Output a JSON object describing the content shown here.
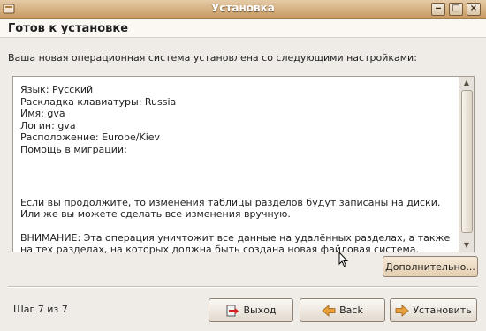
{
  "window": {
    "title": "Установка",
    "icon": "installer-icon",
    "controls": [
      "minimize-icon",
      "maximize-icon",
      "close-icon"
    ]
  },
  "header": {
    "title": "Готов к установке"
  },
  "intro": "Ваша новая операционная система установлена со следующими настройками:",
  "summary": {
    "settings": [
      "Язык: Русский",
      "Раскладка клавиатуры: Russia",
      "Имя: gva",
      "Логин: gva",
      "Расположение: Europe/Kiev",
      "Помощь в миграции:"
    ],
    "partition_note": [
      "Если вы продолжите, то изменения таблицы разделов будут записаны на диски.",
      "Или же вы можете сделать все изменения вручную."
    ],
    "warning": [
      "ВНИМАНИЕ: Эта операция уничтожит все данные на удалённых разделах, а также",
      "на тех разделах, на которых должна быть создана новая файловая система."
    ]
  },
  "advanced_button": "Дополнительно...",
  "step": "Шаг 7 из 7",
  "buttons": {
    "quit": "Выход",
    "back": "Back",
    "install": "Установить"
  },
  "icons": {
    "quit": "exit-icon",
    "back": "back-arrow-icon",
    "install": "forward-arrow-icon"
  },
  "colors": {
    "titlebar": "#c89b63",
    "arrow": "#e8a13a"
  }
}
